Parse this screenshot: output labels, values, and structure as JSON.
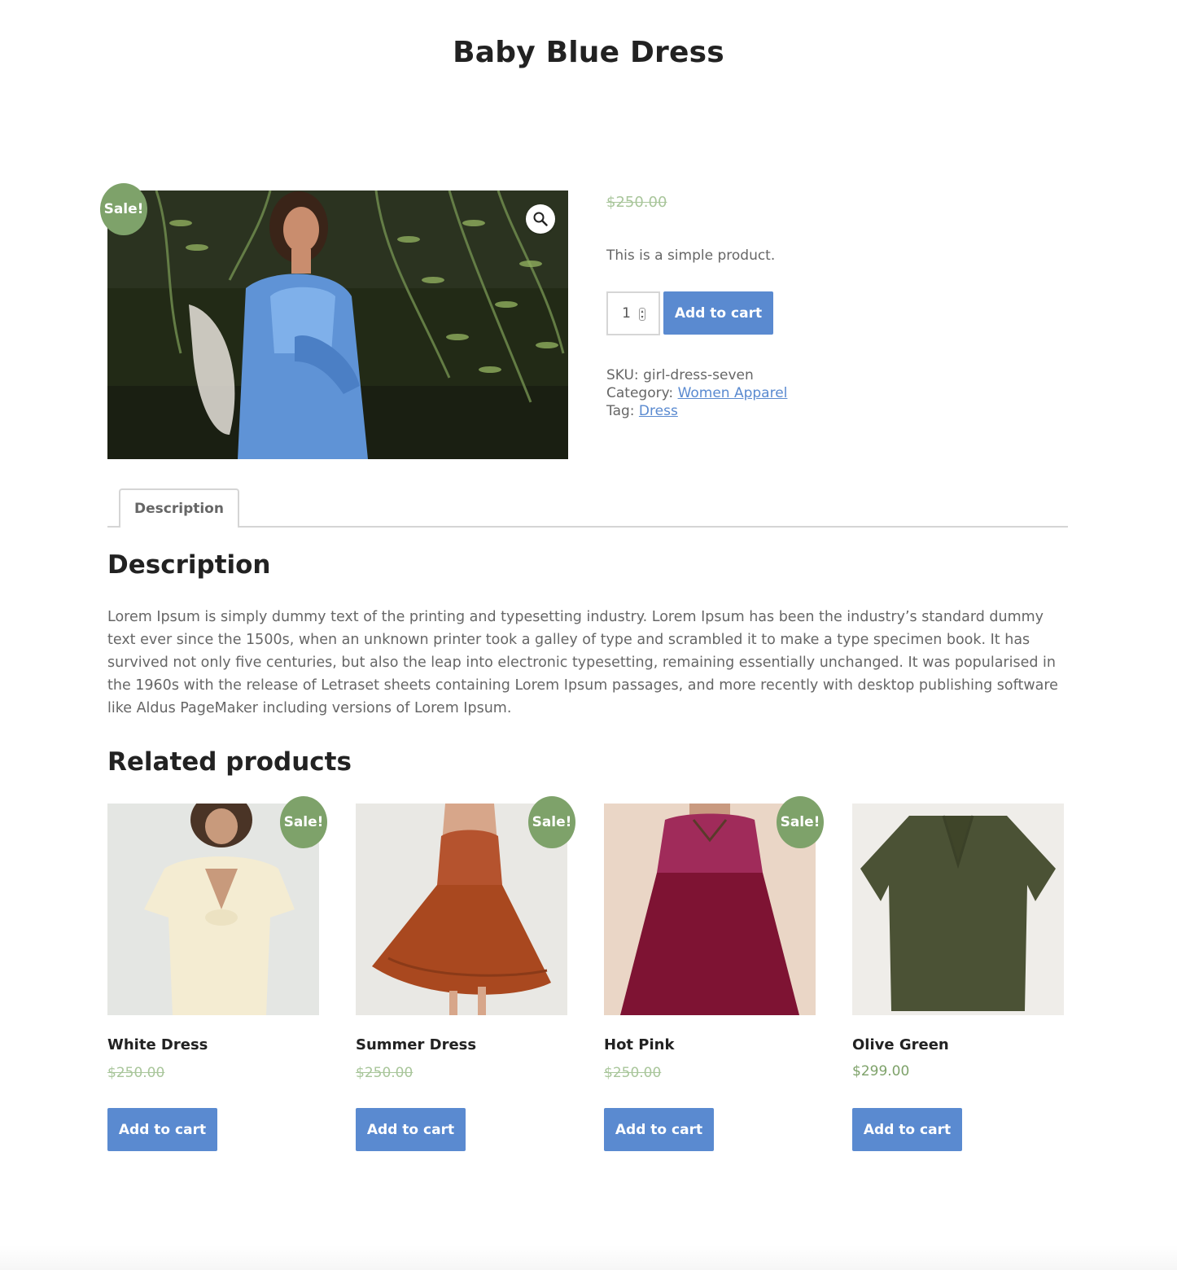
{
  "page": {
    "title": "Baby Blue Dress"
  },
  "product": {
    "sale_badge": "Sale!",
    "old_price": "$250.00",
    "short_description": "This is a simple product.",
    "quantity": "1",
    "add_to_cart": "Add to cart",
    "meta": {
      "sku_label": "SKU:",
      "sku": "girl-dress-seven",
      "category_label": "Category:",
      "category": "Women Apparel",
      "tag_label": "Tag:",
      "tag": "Dress"
    }
  },
  "tabs": {
    "description_tab": "Description"
  },
  "description": {
    "heading": "Description",
    "text": "Lorem Ipsum is simply dummy text of the printing and typesetting industry. Lorem Ipsum has been the industry’s standard dummy text ever since the 1500s, when an unknown printer took a galley of type and scrambled it to make a type specimen book. It has survived not only five centuries, but also the leap into electronic typesetting, remaining essentially unchanged. It was popularised in the 1960s with the release of Letraset sheets containing Lorem Ipsum passages, and more recently with desktop publishing software like Aldus PageMaker including versions of Lorem Ipsum."
  },
  "related": {
    "heading": "Related products",
    "items": [
      {
        "name": "White Dress",
        "price": "$250.00",
        "on_sale": true,
        "badge": "Sale!",
        "button": "Add to cart"
      },
      {
        "name": "Summer Dress",
        "price": "$250.00",
        "on_sale": true,
        "badge": "Sale!",
        "button": "Add to cart"
      },
      {
        "name": "Hot Pink",
        "price": "$250.00",
        "on_sale": true,
        "badge": "Sale!",
        "button": "Add to cart"
      },
      {
        "name": "Olive Green",
        "price": "$299.00",
        "on_sale": false,
        "button": "Add to cart"
      }
    ]
  },
  "colors": {
    "accent_blue": "#5a8ad0",
    "sale_green": "#7ea26a",
    "old_price_green": "#a9c69b"
  },
  "icons": {
    "zoom": "magnifier-icon"
  }
}
